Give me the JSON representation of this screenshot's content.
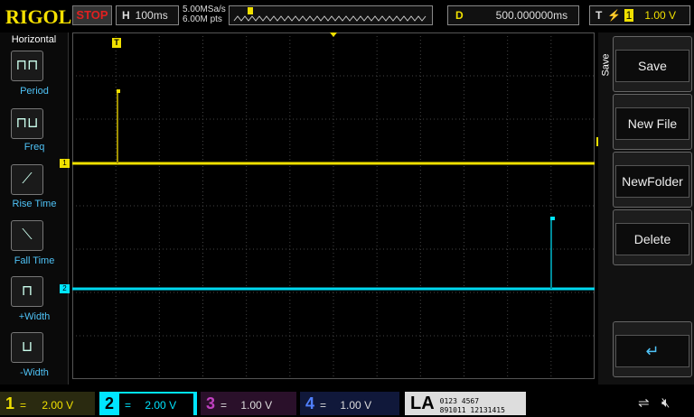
{
  "header": {
    "logo": "RIGOL",
    "run_state": "STOP",
    "timebase_label": "H",
    "timebase": "100ms",
    "sample_rate": "5.00MSa/s",
    "memory_depth": "6.00M pts",
    "delay_label": "D",
    "delay": "500.000000ms",
    "trigger_label": "T",
    "trigger_source": "1",
    "trigger_level": "1.00 V"
  },
  "left_menu": {
    "title": "Horizontal",
    "items": [
      {
        "label": "Period",
        "icon": "period-icon"
      },
      {
        "label": "Freq",
        "icon": "freq-icon"
      },
      {
        "label": "Rise Time",
        "icon": "rise-time-icon"
      },
      {
        "label": "Fall Time",
        "icon": "fall-time-icon"
      },
      {
        "label": "+Width",
        "icon": "pos-width-icon"
      },
      {
        "label": "-Width",
        "icon": "neg-width-icon"
      }
    ]
  },
  "right_menu": {
    "title": "Save",
    "items": [
      "Save",
      "New File",
      "NewFolder",
      "Delete"
    ],
    "enter_icon": "enter-icon"
  },
  "channels": [
    {
      "num": "1",
      "coupling": "=",
      "scale": "2.00 V",
      "color": "#f0e000"
    },
    {
      "num": "2",
      "coupling": "=",
      "scale": "2.00 V",
      "color": "#00e5ff"
    },
    {
      "num": "3",
      "coupling": "=",
      "scale": "1.00 V",
      "color": "#c040c0"
    },
    {
      "num": "4",
      "coupling": "=",
      "scale": "1.00 V",
      "color": "#3060ff"
    }
  ],
  "la": {
    "label": "LA",
    "row1": "0123 4567",
    "row2": "891011 12131415"
  },
  "status_icons": [
    "usb-icon",
    "speaker-muted-icon"
  ],
  "markers": {
    "trigger": "T",
    "ch1": "1",
    "ch2": "2"
  }
}
